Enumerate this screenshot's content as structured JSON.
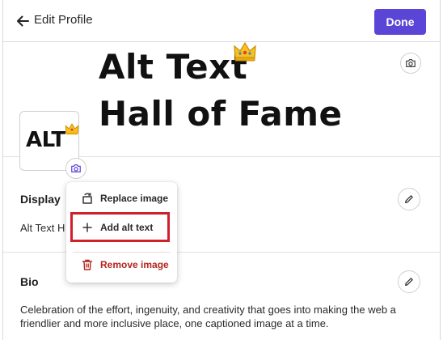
{
  "header": {
    "back_icon": "arrow-left-icon",
    "title": "Edit Profile",
    "done_label": "Done",
    "accent": "#5b45d6"
  },
  "banner": {
    "line1": "Alt Text",
    "line2": "Hall of Fame",
    "decor_icon": "crown-icon",
    "camera_icon": "camera-icon"
  },
  "avatar": {
    "text": "ALT",
    "decor_icon": "crown-icon",
    "camera_icon": "camera-icon"
  },
  "display_name": {
    "label": "Display",
    "value": "Alt Text H",
    "edit_icon": "pencil-icon"
  },
  "image_menu": {
    "items": [
      {
        "label": "Replace image",
        "icon": "replace-image-icon"
      },
      {
        "label": "Add alt text",
        "icon": "plus-icon"
      },
      {
        "label": "Remove image",
        "icon": "trash-icon"
      }
    ],
    "danger_color": "#b3261e",
    "highlight_color": "#d0202a"
  },
  "bio": {
    "label": "Bio",
    "edit_icon": "pencil-icon",
    "text": "Celebration of the effort, ingenuity, and creativity that goes into making the web a friendlier and more inclusive place, one captioned image at a time."
  }
}
